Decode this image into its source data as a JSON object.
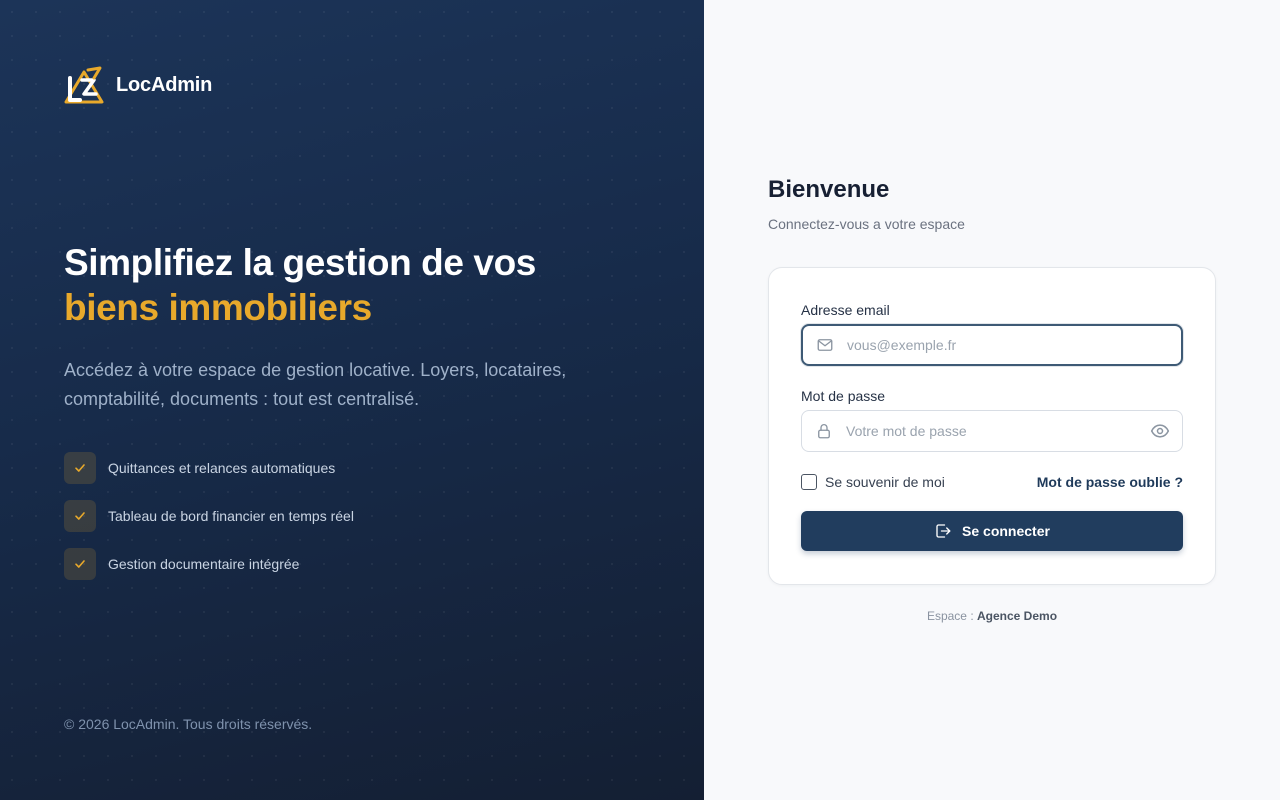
{
  "brand": {
    "name": "LocAdmin"
  },
  "hero": {
    "title_line1": "Simplifiez la gestion de vos",
    "title_line2": "biens immobiliers",
    "description": "Accédez à votre espace de gestion locative. Loyers, locataires, comptabilité, documents : tout est centralisé."
  },
  "features": [
    {
      "label": "Quittances et relances automatiques",
      "icon": "check-icon"
    },
    {
      "label": "Tableau de bord financier en temps réel",
      "icon": "check-icon"
    },
    {
      "label": "Gestion documentaire intégrée",
      "icon": "check-icon"
    }
  ],
  "copyright": "© 2026 LocAdmin. Tous droits réservés.",
  "login": {
    "title": "Bienvenue",
    "subtitle": "Connectez-vous a votre espace",
    "email_label": "Adresse email",
    "email_placeholder": "vous@exemple.fr",
    "email_value": "",
    "password_label": "Mot de passe",
    "password_placeholder": "Votre mot de passe",
    "password_value": "",
    "remember_label": "Se souvenir de moi",
    "remember_checked": false,
    "forgot_label": "Mot de passe oublie ?",
    "submit_label": "Se connecter"
  },
  "space": {
    "prefix": "Espace :",
    "name": "Agence Demo"
  },
  "colors": {
    "accent": "#e8a92b",
    "primary": "#213d5e",
    "panel_dark": "#172b4a",
    "background": "#f8f9fb"
  }
}
